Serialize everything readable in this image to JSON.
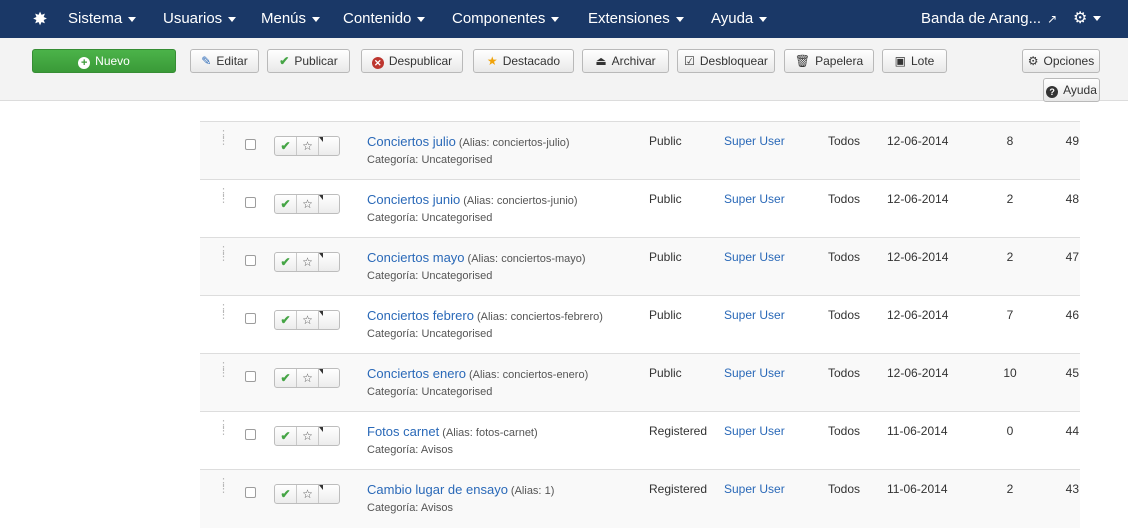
{
  "navbar": {
    "logo_icon": "joomla-logo-icon",
    "menus": [
      "Sistema",
      "Usuarios",
      "Menús",
      "Contenido",
      "Componentes",
      "Extensiones",
      "Ayuda"
    ],
    "site_name": "Banda de Arang...",
    "external_icon": "external-link-icon",
    "settings_icon": "gear-icon"
  },
  "toolbar": {
    "new": "Nuevo",
    "edit": "Editar",
    "publish": "Publicar",
    "unpublish": "Despublicar",
    "featured": "Destacado",
    "archive": "Archivar",
    "unlock": "Desbloquear",
    "trash": "Papelera",
    "batch": "Lote",
    "options": "Opciones",
    "help": "Ayuda"
  },
  "table": {
    "category_prefix": "Categoría:",
    "alias_prefix": "Alias:",
    "rows": [
      {
        "title": "Conciertos julio",
        "alias": "conciertos-julio",
        "category": "Uncategorised",
        "access": "Public",
        "author": "Super User",
        "language": "Todos",
        "date": "12-06-2014",
        "hits": "8",
        "id": "49"
      },
      {
        "title": "Conciertos junio",
        "alias": "conciertos-junio",
        "category": "Uncategorised",
        "access": "Public",
        "author": "Super User",
        "language": "Todos",
        "date": "12-06-2014",
        "hits": "2",
        "id": "48"
      },
      {
        "title": "Conciertos mayo",
        "alias": "conciertos-mayo",
        "category": "Uncategorised",
        "access": "Public",
        "author": "Super User",
        "language": "Todos",
        "date": "12-06-2014",
        "hits": "2",
        "id": "47"
      },
      {
        "title": "Conciertos febrero",
        "alias": "conciertos-febrero",
        "category": "Uncategorised",
        "access": "Public",
        "author": "Super User",
        "language": "Todos",
        "date": "12-06-2014",
        "hits": "7",
        "id": "46"
      },
      {
        "title": "Conciertos enero",
        "alias": "conciertos-enero",
        "category": "Uncategorised",
        "access": "Public",
        "author": "Super User",
        "language": "Todos",
        "date": "12-06-2014",
        "hits": "10",
        "id": "45"
      },
      {
        "title": "Fotos carnet",
        "alias": "fotos-carnet",
        "category": "Avisos",
        "access": "Registered",
        "author": "Super User",
        "language": "Todos",
        "date": "11-06-2014",
        "hits": "0",
        "id": "44"
      },
      {
        "title": "Cambio lugar de ensayo",
        "alias": "1",
        "category": "Avisos",
        "access": "Registered",
        "author": "Super User",
        "language": "Todos",
        "date": "11-06-2014",
        "hits": "2",
        "id": "43"
      }
    ]
  },
  "colors": {
    "navbar": "#1a3867",
    "new_button": "#46a546",
    "link": "#2a69b8",
    "publish_check": "#46a546",
    "unpublish_icon": "#bd362f",
    "featured_star": "#f0a30a"
  }
}
